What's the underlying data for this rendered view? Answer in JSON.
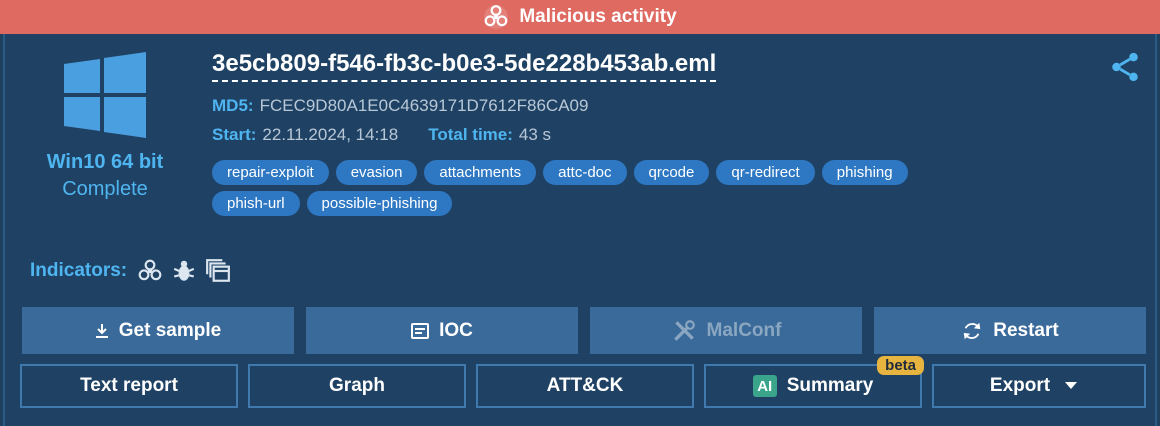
{
  "banner": {
    "label": "Malicious activity",
    "color": "#de6a62",
    "icon": "biohazard-icon"
  },
  "os": {
    "name": "Win10 64 bit",
    "status": "Complete",
    "icon": "windows-logo-icon"
  },
  "task": {
    "filename": "3e5cb809-f546-fb3c-b0e3-5de228b453ab.eml",
    "md5_label": "MD5:",
    "md5": "FCEC9D80A1E0C4639171D7612F86CA09",
    "start_label": "Start:",
    "start": "22.11.2024, 14:18",
    "total_label": "Total time:",
    "total": "43 s"
  },
  "tags": [
    "repair-exploit",
    "evasion",
    "attachments",
    "attc-doc",
    "qrcode",
    "qr-redirect",
    "phishing",
    "phish-url",
    "possible-phishing"
  ],
  "indicators": {
    "label": "Indicators:",
    "icons": [
      "biohazard-icon",
      "bug-icon",
      "windows-stack-icon"
    ]
  },
  "actions": {
    "get_sample": "Get sample",
    "ioc": "IOC",
    "malconf": "MalConf",
    "restart": "Restart"
  },
  "reports": {
    "text_report": "Text report",
    "graph": "Graph",
    "attck": "ATT&CK",
    "ai_badge": "AI",
    "summary": "Summary",
    "beta": "beta",
    "export": "Export"
  },
  "colors": {
    "accent": "#4fb5f0",
    "tag": "#2e78c3",
    "panel": "#1f4264",
    "beta": "#e8b440"
  }
}
